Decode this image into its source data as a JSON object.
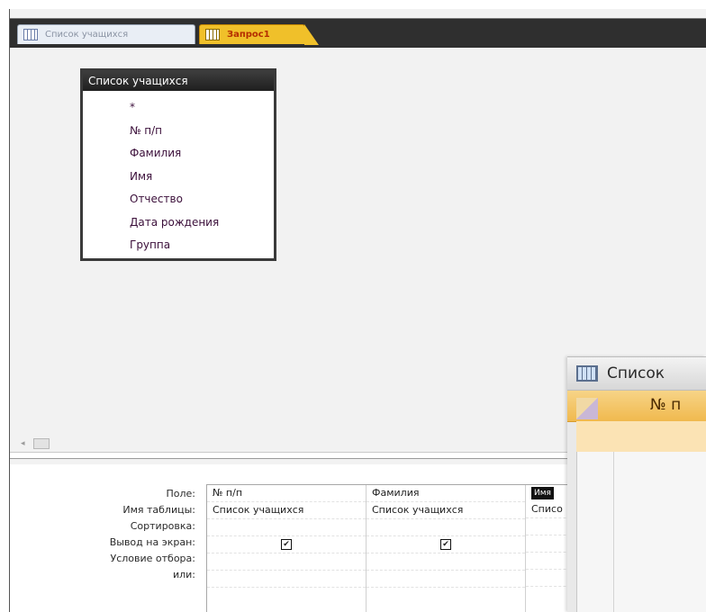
{
  "tabs": [
    {
      "label": "Список учащихся",
      "active": false
    },
    {
      "label": "Запрос1",
      "active": true
    }
  ],
  "field_list": {
    "title": "Список учащихся",
    "fields": [
      "*",
      "№ п/п",
      "Фамилия",
      "Имя",
      "Отчество",
      "Дата рождения",
      "Группа"
    ]
  },
  "grid": {
    "row_labels": [
      "Поле:",
      "Имя таблицы:",
      "Сортировка:",
      "Вывод на экран:",
      "Условие отбора:",
      "или:"
    ],
    "columns": [
      {
        "field": "№ п/п",
        "table": "Список учащихся",
        "show": true
      },
      {
        "field": "Фамилия",
        "table": "Список учащихся",
        "show": true
      },
      {
        "field": "Имя",
        "table": "Списо",
        "show": null
      }
    ]
  },
  "datasheet": {
    "title": "Список",
    "column_header": "№ п"
  },
  "checkbox_glyph": "✔",
  "scroll_arrow": "◂",
  "colors": {
    "active_tab": "#f0c02a",
    "active_tab_text": "#b42d00",
    "tabbar": "#2f2f2f"
  }
}
